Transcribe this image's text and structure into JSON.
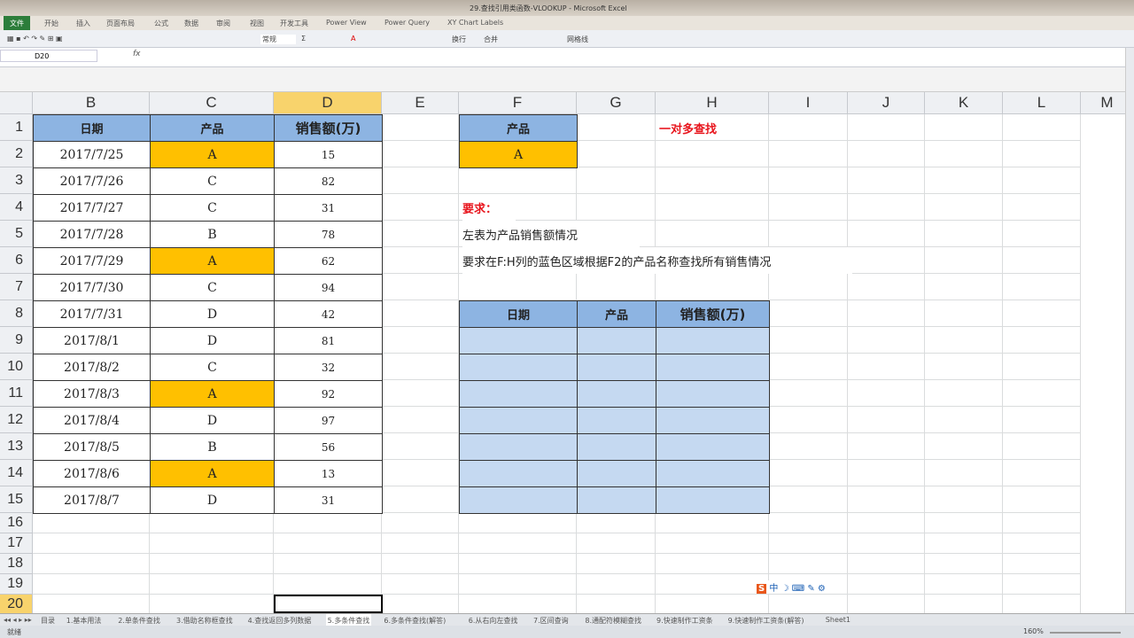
{
  "window": {
    "title": "29.查找引用类函数-VLOOKUP - Microsoft Excel"
  },
  "menu": [
    "文件",
    "开始",
    "插入",
    "页面布局",
    "公式",
    "数据",
    "审阅",
    "视图",
    "开发工具",
    "Power View",
    "Power Query",
    "XY Chart Labels"
  ],
  "toolbar": {
    "number_format": "常规",
    "wrap": "换行",
    "merge": "合并",
    "gridlines": "网格线"
  },
  "formula_bar": {
    "name_box": "D20",
    "fx": "fx",
    "value": ""
  },
  "columns": [
    "B",
    "C",
    "D",
    "E",
    "F",
    "G",
    "H",
    "I",
    "J",
    "K",
    "L",
    "M"
  ],
  "rows": [
    "1",
    "2",
    "3",
    "4",
    "5",
    "6",
    "7",
    "8",
    "9",
    "10",
    "11",
    "12",
    "13",
    "14",
    "15",
    "16",
    "17",
    "18",
    "19",
    "20"
  ],
  "table": {
    "headers": [
      "日期",
      "产品",
      "销售额(万)"
    ],
    "rows": [
      [
        "2017/7/25",
        "A",
        "15"
      ],
      [
        "2017/7/26",
        "C",
        "82"
      ],
      [
        "2017/7/27",
        "C",
        "31"
      ],
      [
        "2017/7/28",
        "B",
        "78"
      ],
      [
        "2017/7/29",
        "A",
        "62"
      ],
      [
        "2017/7/30",
        "C",
        "94"
      ],
      [
        "2017/7/31",
        "D",
        "42"
      ],
      [
        "2017/8/1",
        "D",
        "81"
      ],
      [
        "2017/8/2",
        "C",
        "32"
      ],
      [
        "2017/8/3",
        "A",
        "92"
      ],
      [
        "2017/8/4",
        "D",
        "97"
      ],
      [
        "2017/8/5",
        "B",
        "56"
      ],
      [
        "2017/8/6",
        "A",
        "13"
      ],
      [
        "2017/8/7",
        "D",
        "31"
      ]
    ]
  },
  "lookup": {
    "header": "产品",
    "value": "A",
    "title": "一对多查找"
  },
  "requirements": {
    "label": "要求：",
    "line1": "左表为产品销售额情况",
    "line2": "要求在F:H列的蓝色区域根据F2的产品名称查找所有销售情况"
  },
  "result_table": {
    "headers": [
      "日期",
      "产品",
      "销售额(万)"
    ],
    "row_count": 7
  },
  "sheet_tabs": [
    "目录",
    "1.基本用法",
    "2.单条件查找",
    "3.借助名称框查找",
    "4.查找返回多列数据",
    "5.多条件查找",
    "6.多条件查找(解答)",
    "6.从右向左查找",
    "7.区间查询",
    "8.通配符模糊查找",
    "9.快速制作工资条",
    "9.快速制作工资条(解答)",
    "Sheet1"
  ],
  "active_tab": "5.多条件查找",
  "status": {
    "mode": "就绪",
    "zoom": "160%"
  },
  "ime": {
    "label": "中"
  },
  "colors": {
    "header_blue": "#8db4e2",
    "result_blue": "#c5d9f1",
    "highlight": "#ffc000",
    "red": "#e8141c"
  }
}
